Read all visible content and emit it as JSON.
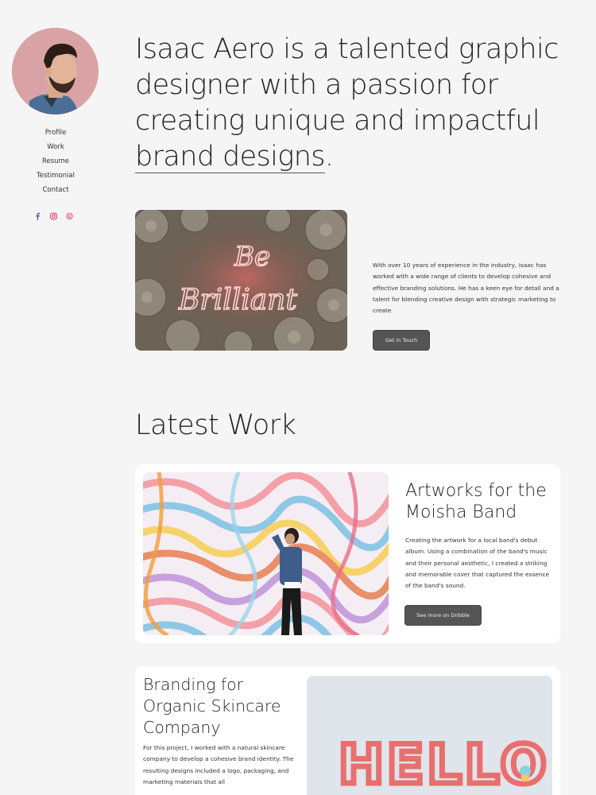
{
  "profile": {
    "name_image": "avatar-photo",
    "nav": [
      "Profile",
      "Work",
      "Resume",
      "Testimonial",
      "Contact"
    ],
    "socials": [
      "facebook-icon",
      "instagram-icon",
      "dribbble-icon"
    ]
  },
  "hero": {
    "title_main": "Isaac Aero is a talented graphic designer with a passion for creating unique and impactful",
    "title_highlight": "brand designs",
    "title_end": ".",
    "image_text_line1": "Be",
    "image_text_line2": "Brilliant",
    "about": "With over 10 years of experience in the industry, Isaac has worked with a wide range of clients to develop cohesive and effective branding solutions. He has a keen eye for detail and a talent for blending creative design with strategic marketing to create",
    "button": "Get in Touch"
  },
  "latest": {
    "heading": "Latest Work",
    "projects": [
      {
        "title": "Artworks for the Moisha Band",
        "description": "Creating the artwork for a local band's debut album. Using a combination of the band's music and their personal aesthetic, I created a striking and memorable cover that captured the essence of the band's sound.",
        "button": "See more on Dribble"
      },
      {
        "title": "Branding for Organic Skincare Company",
        "description": "For this project, I worked with a natural skincare company to develop a cohesive brand identity. The resulting designs included a logo, packaging, and marketing materials that all",
        "image_text": "HELLO"
      }
    ]
  },
  "colors": {
    "background": "#f5f5f6",
    "button": "#555555",
    "accent_avatar": "#d9a3a6",
    "facebook": "#3b5998",
    "instagram": "#e1306c",
    "dribbble": "#ea4c89"
  }
}
